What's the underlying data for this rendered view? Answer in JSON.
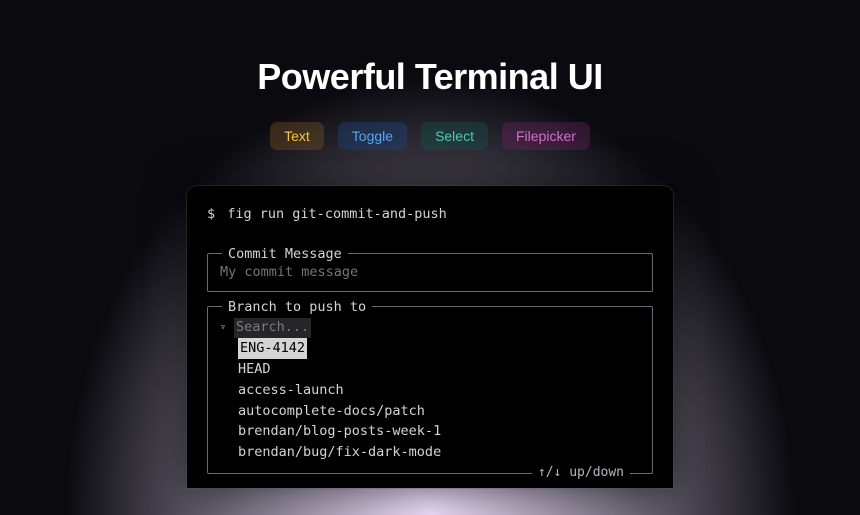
{
  "heading": "Powerful Terminal UI",
  "tabs": {
    "text": "Text",
    "toggle": "Toggle",
    "select": "Select",
    "filepicker": "Filepicker"
  },
  "terminal": {
    "prompt_symbol": "$",
    "command": "fig run git-commit-and-push",
    "commit_field": {
      "label": "Commit Message",
      "placeholder": "My commit message"
    },
    "branch_field": {
      "label": "Branch to push to",
      "caret": "▿",
      "search_placeholder": "Search...",
      "items": [
        "ENG-4142",
        "HEAD",
        "access-launch",
        "autocomplete-docs/patch",
        "brendan/blog-posts-week-1",
        "brendan/bug/fix-dark-mode"
      ],
      "selected_index": 0,
      "hint": "↑/↓ up/down"
    }
  }
}
